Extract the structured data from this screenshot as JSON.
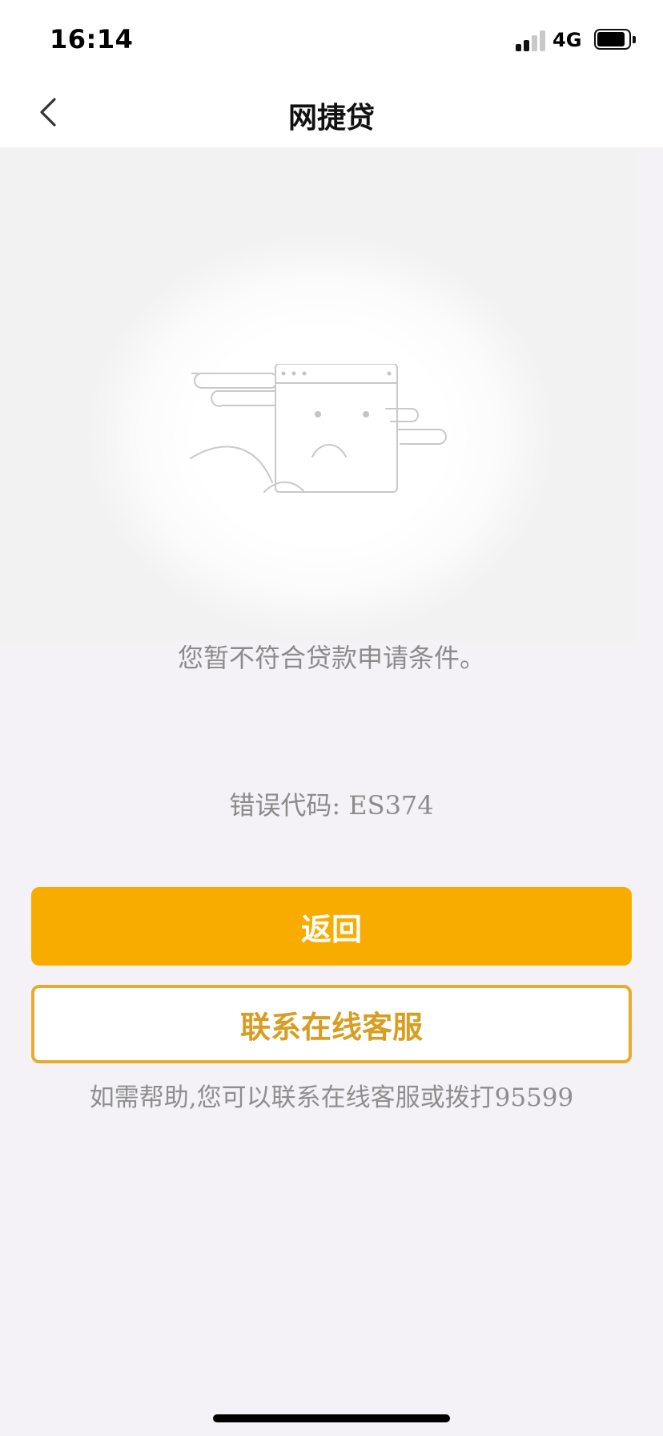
{
  "status_bar": {
    "time": "16:14",
    "network": "4G",
    "signal_bars_active": 2,
    "signal_bars_total": 4,
    "battery_level": 0.8
  },
  "nav": {
    "title": "网捷贷",
    "back_icon": "chevron-left-icon"
  },
  "illustration": {
    "icon": "sad-browser-window-icon"
  },
  "content": {
    "message": "您暂不符合贷款申请条件。",
    "error_code": "错误代码: ES374"
  },
  "actions": {
    "return_label": "返回",
    "service_label": "联系在线客服"
  },
  "help": {
    "text": "如需帮助,您可以联系在线客服或拨打95599"
  },
  "colors": {
    "primary": "#f9ac00",
    "outline": "#e5ac2e",
    "secondary_text": "#8b8b8b",
    "background": "#f4f2f6"
  }
}
